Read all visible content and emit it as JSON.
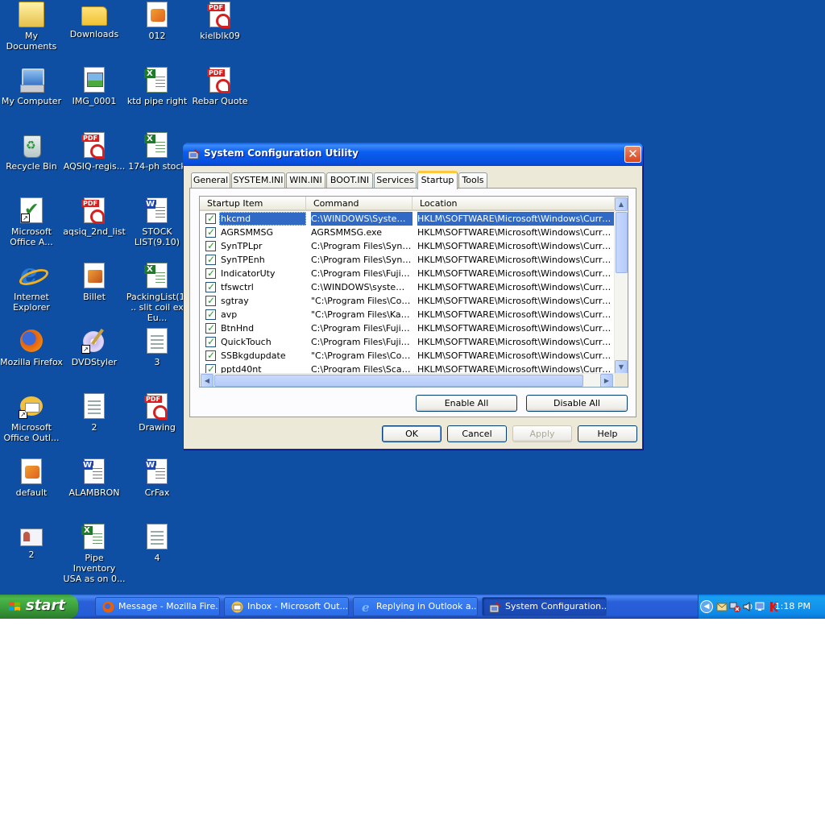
{
  "desktop": {
    "icons": [
      {
        "label": "My Documents",
        "kind": "docs"
      },
      {
        "label": "Downloads",
        "kind": "folder"
      },
      {
        "label": "012",
        "kind": "pack"
      },
      {
        "label": "kielblk09",
        "kind": "pdf"
      },
      {
        "label": "My Computer",
        "kind": "computer"
      },
      {
        "label": "IMG_0001",
        "kind": "img"
      },
      {
        "label": "ktd pipe right",
        "kind": "xls"
      },
      {
        "label": "Rebar Quote",
        "kind": "pdf"
      },
      {
        "label": "Recycle Bin",
        "kind": "recycle"
      },
      {
        "label": "AQSIQ-regis...",
        "kind": "pdf"
      },
      {
        "label": "174-ph stock",
        "kind": "xls"
      },
      {
        "label": "Microsoft Office A...",
        "kind": "msoffice"
      },
      {
        "label": "aqsiq_2nd_list",
        "kind": "pdf"
      },
      {
        "label": "STOCK LIST(9.10)",
        "kind": "word"
      },
      {
        "label": "Internet Explorer",
        "kind": "ie"
      },
      {
        "label": "Billet",
        "kind": "billet"
      },
      {
        "label": "PackingList(1... slit coil ex Eu...",
        "kind": "xls"
      },
      {
        "label": "Mozilla Firefox",
        "kind": "firefox"
      },
      {
        "label": "DVDStyler",
        "kind": "dvd"
      },
      {
        "label": "3",
        "kind": "doc"
      },
      {
        "label": "Microsoft Office Outl...",
        "kind": "outlook"
      },
      {
        "label": "2",
        "kind": "doc"
      },
      {
        "label": "Drawing",
        "kind": "pdf"
      },
      {
        "label": "default",
        "kind": "pack"
      },
      {
        "label": "ALAMBRON",
        "kind": "word"
      },
      {
        "label": "CrFax",
        "kind": "word"
      },
      {
        "label": "2",
        "kind": "card"
      },
      {
        "label": "Pipe Inventory USA as on 0...",
        "kind": "xls"
      },
      {
        "label": "4",
        "kind": "doc"
      }
    ]
  },
  "dialog": {
    "title": "System Configuration Utility",
    "close_symbol": "✕",
    "tabs": [
      "General",
      "SYSTEM.INI",
      "WIN.INI",
      "BOOT.INI",
      "Services",
      "Startup",
      "Tools"
    ],
    "active_tab": "Startup",
    "columns": [
      "Startup Item",
      "Command",
      "Location"
    ],
    "rows": [
      {
        "item": "hkcmd",
        "command": "C:\\WINDOWS\\System...",
        "location": "HKLM\\SOFTWARE\\Microsoft\\Windows\\CurrentVer...",
        "checked": true,
        "selected": true
      },
      {
        "item": "AGRSMMSG",
        "command": "AGRSMMSG.exe",
        "location": "HKLM\\SOFTWARE\\Microsoft\\Windows\\CurrentVer...",
        "checked": true
      },
      {
        "item": "SynTPLpr",
        "command": "C:\\Program Files\\Syna...",
        "location": "HKLM\\SOFTWARE\\Microsoft\\Windows\\CurrentVer...",
        "checked": true
      },
      {
        "item": "SynTPEnh",
        "command": "C:\\Program Files\\Syna...",
        "location": "HKLM\\SOFTWARE\\Microsoft\\Windows\\CurrentVer...",
        "checked": true
      },
      {
        "item": "IndicatorUty",
        "command": "C:\\Program Files\\Fujit...",
        "location": "HKLM\\SOFTWARE\\Microsoft\\Windows\\CurrentVer...",
        "checked": true
      },
      {
        "item": "tfswctrl",
        "command": "C:\\WINDOWS\\system...",
        "location": "HKLM\\SOFTWARE\\Microsoft\\Windows\\CurrentVer...",
        "checked": true
      },
      {
        "item": "sgtray",
        "command": "\"C:\\Program Files\\Com...",
        "location": "HKLM\\SOFTWARE\\Microsoft\\Windows\\CurrentVer...",
        "checked": true
      },
      {
        "item": "avp",
        "command": "\"C:\\Program Files\\Kas...",
        "location": "HKLM\\SOFTWARE\\Microsoft\\Windows\\CurrentVer...",
        "checked": true
      },
      {
        "item": "BtnHnd",
        "command": "C:\\Program Files\\Fujit...",
        "location": "HKLM\\SOFTWARE\\Microsoft\\Windows\\CurrentVer...",
        "checked": true
      },
      {
        "item": "QuickTouch",
        "command": "C:\\Program Files\\Fujit...",
        "location": "HKLM\\SOFTWARE\\Microsoft\\Windows\\CurrentVer...",
        "checked": true
      },
      {
        "item": "SSBkgdupdate",
        "command": "\"C:\\Program Files\\Com...",
        "location": "HKLM\\SOFTWARE\\Microsoft\\Windows\\CurrentVer...",
        "checked": true
      },
      {
        "item": "pptd40nt",
        "command": "C:\\Program Files\\Scan...",
        "location": "HKLM\\SOFTWARE\\Microsoft\\Windows\\CurrentVer...",
        "checked": true
      }
    ],
    "enable_all": "Enable All",
    "disable_all": "Disable All",
    "ok": "OK",
    "cancel": "Cancel",
    "apply": "Apply",
    "help": "Help"
  },
  "taskbar": {
    "start_label": "start",
    "buttons": [
      {
        "label": "Message - Mozilla Fire...",
        "icon": "firefox-icon"
      },
      {
        "label": "Inbox - Microsoft Out...",
        "icon": "outlook-icon"
      },
      {
        "label": "Replying in Outlook a...",
        "icon": "ie-icon"
      },
      {
        "label": "System Configuration...",
        "icon": "msconfig-icon",
        "active": true
      }
    ],
    "clock": "1:18 PM"
  },
  "colors": {
    "desktop": "#0f4fa3",
    "selection": "#316ac5",
    "titlebar": "#0a5ef0",
    "start": "#3a9a3a"
  }
}
